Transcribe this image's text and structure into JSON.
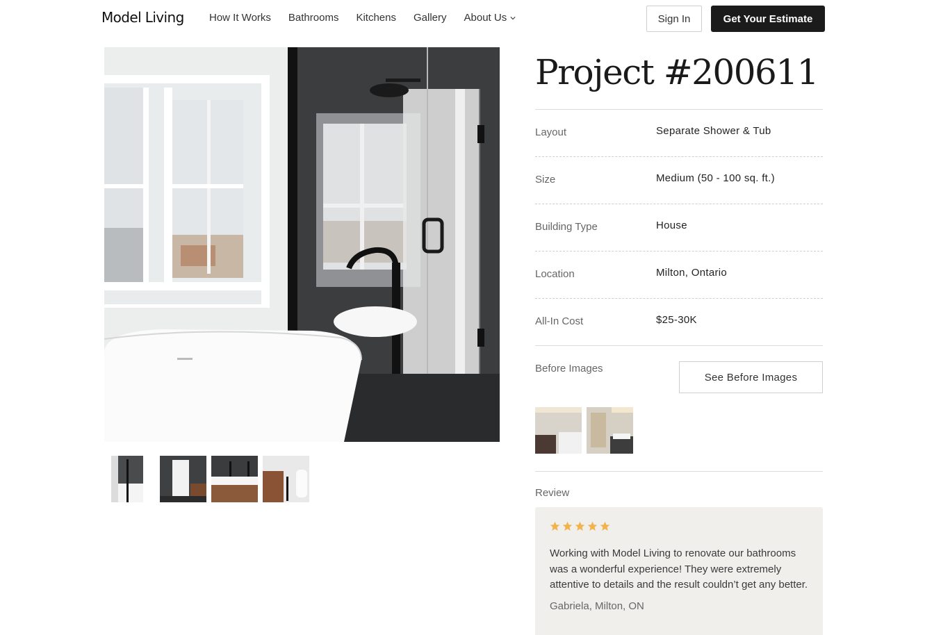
{
  "nav": {
    "logo": "Model Living",
    "links": [
      "How It Works",
      "Bathrooms",
      "Kitchens",
      "Gallery",
      "About Us"
    ],
    "sign_in": "Sign In",
    "estimate": "Get Your Estimate"
  },
  "project": {
    "title": "Project #200611",
    "specs": [
      {
        "label": "Layout",
        "value": "Separate Shower & Tub"
      },
      {
        "label": "Size",
        "value": "Medium (50 - 100 sq. ft.)"
      },
      {
        "label": "Building Type",
        "value": "House"
      },
      {
        "label": "Location",
        "value": "Milton, Ontario"
      },
      {
        "label": "All-In Cost",
        "value": "$25-30K"
      }
    ],
    "before_label": "Before Images",
    "before_button": "See Before Images",
    "review_label": "Review",
    "review": {
      "rating": 5,
      "text": "Working with Model Living to renovate our bathrooms was a wonderful experience! They were extremely attentive to details and the result couldn’t get any better.",
      "author": "Gabriela, Milton, ON"
    }
  },
  "colors": {
    "star": "#f2b24c",
    "primary_button": "#1b1b1b",
    "review_bg": "#f1efec"
  }
}
